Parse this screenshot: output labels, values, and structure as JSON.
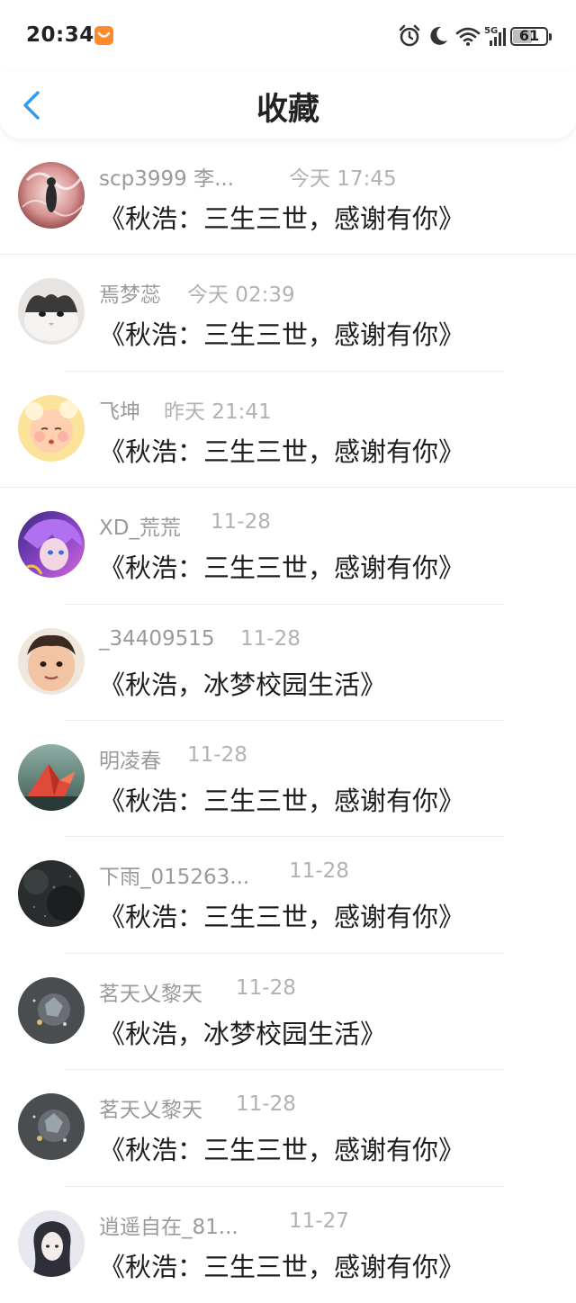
{
  "status_bar": {
    "time": "20:34",
    "network": "5G",
    "battery_level": "61"
  },
  "header": {
    "title": "收藏",
    "back_icon": "chevron-left-icon"
  },
  "colors": {
    "accent": "#2e9bf0",
    "username": "#9a9a9a",
    "timestamp": "#b2b2b2",
    "title_text": "#1e1e1e",
    "status_badge": "#ff8a2a"
  },
  "items": [
    {
      "user": "scp3999 李...",
      "time": "今天 17:45",
      "title": "《秋浩：三生三世，感谢有你》"
    },
    {
      "user": "焉梦蕊",
      "time": "今天 02:39",
      "title": "《秋浩：三生三世，感谢有你》"
    },
    {
      "user": "飞坤",
      "time": "昨天 21:41",
      "title": "《秋浩：三生三世，感谢有你》"
    },
    {
      "user": "XD_荒荒",
      "time": "11-28",
      "title": "《秋浩：三生三世，感谢有你》"
    },
    {
      "user": "_34409515",
      "time": "11-28",
      "title": "《秋浩，冰梦校园生活》"
    },
    {
      "user": "明凌春",
      "time": "11-28",
      "title": "《秋浩：三生三世，感谢有你》"
    },
    {
      "user": "下雨_015263...",
      "time": "11-28",
      "title": "《秋浩：三生三世，感谢有你》"
    },
    {
      "user": "茗天乂黎天",
      "time": "11-28",
      "title": "《秋浩，冰梦校园生活》"
    },
    {
      "user": "茗天乂黎天",
      "time": "11-28",
      "title": "《秋浩：三生三世，感谢有你》"
    },
    {
      "user": "逍遥自在_81...",
      "time": "11-27",
      "title": "《秋浩：三生三世，感谢有你》"
    }
  ]
}
